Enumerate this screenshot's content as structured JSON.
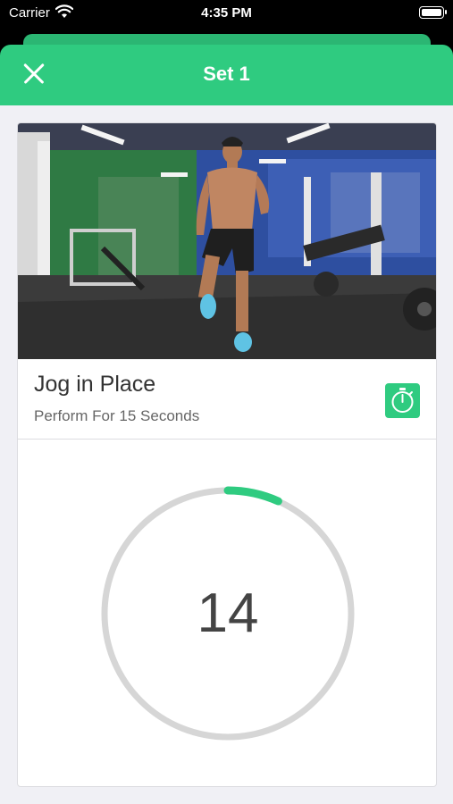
{
  "status_bar": {
    "carrier": "Carrier",
    "time": "4:35 PM"
  },
  "nav": {
    "title": "Set 1",
    "close_icon": "close-icon"
  },
  "exercise": {
    "name": "Jog in Place",
    "subtitle": "Perform For 15 Seconds",
    "image_description_icon": "gym-photo",
    "timer_icon": "stopwatch-icon"
  },
  "countdown": {
    "value": "14",
    "progress": 0.067,
    "ring_color": "#d6d6d6",
    "progress_color": "#2fcb80"
  },
  "colors": {
    "accent": "#2fcb80"
  }
}
